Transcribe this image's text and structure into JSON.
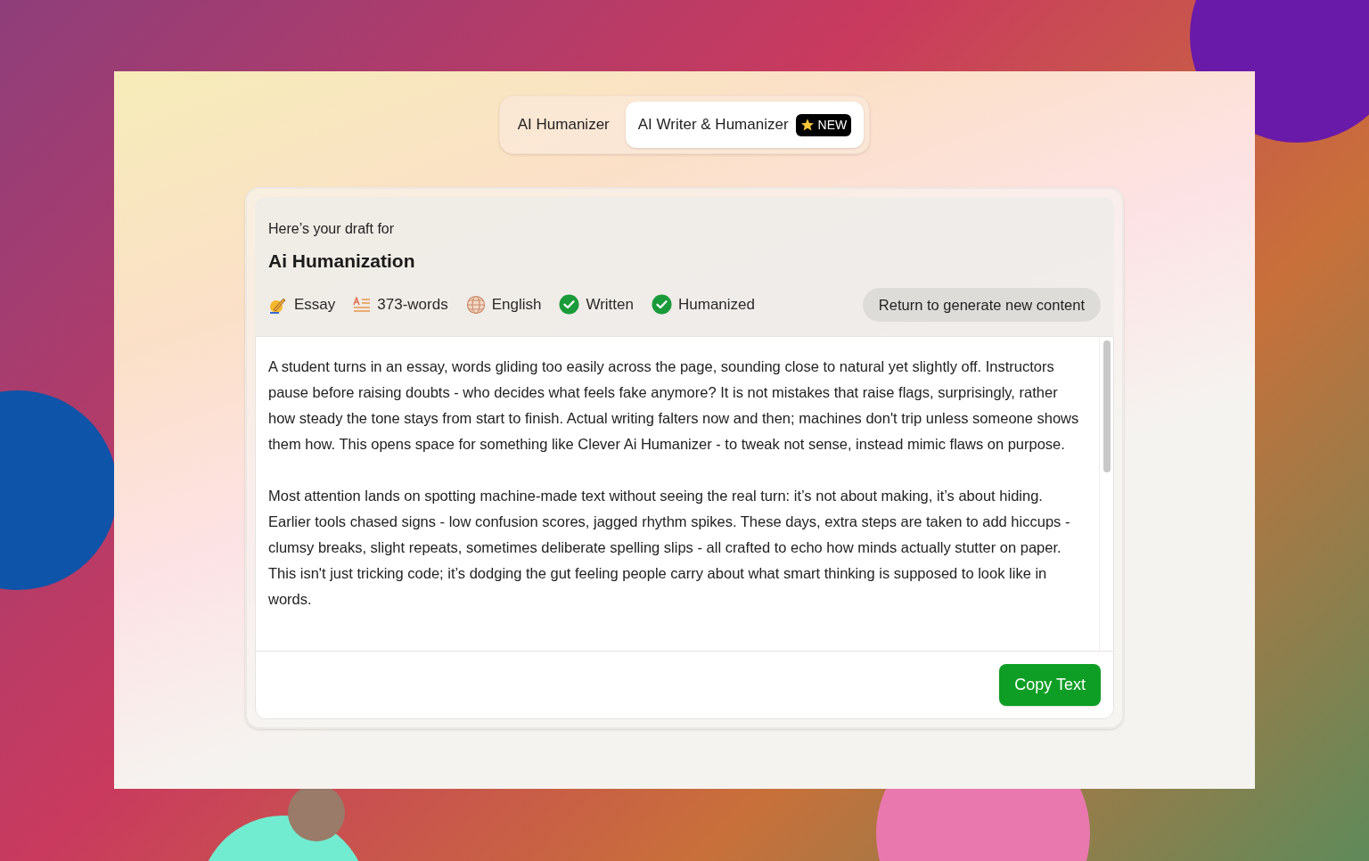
{
  "tabs": [
    {
      "label": "AI Humanizer",
      "selected": false
    },
    {
      "label": "AI Writer & Humanizer",
      "selected": true,
      "badge": "NEW"
    }
  ],
  "draft": {
    "intro": "Here’s your draft for",
    "title": "Ai Humanization",
    "meta": [
      {
        "kind": "pencil",
        "label": "Essay"
      },
      {
        "kind": "lines",
        "label": "373-words"
      },
      {
        "kind": "globe",
        "label": "English"
      },
      {
        "kind": "check",
        "label": "Written"
      },
      {
        "kind": "check",
        "label": "Humanized"
      }
    ],
    "return_button": "Return to generate new content",
    "paragraphs": [
      "A student turns in an essay, words gliding too easily across the page, sounding close to natural yet slightly off. Instructors pause before raising doubts - who decides what feels fake anymore? It is not mistakes that raise flags, surprisingly, rather how steady the tone stays from start to finish. Actual writing falters now and then; machines don't trip unless someone shows them how. This opens space for something like Clever Ai Humanizer - to tweak not sense, instead mimic flaws on purpose.",
      "Most attention lands on spotting machine-made text without seeing the real turn: it’s not about making, it’s about hiding. Earlier tools chased signs - low confusion scores, jagged rhythm spikes. These days, extra steps are taken to add hiccups - clumsy breaks, slight repeats, sometimes deliberate spelling slips - all crafted to echo how minds actually stutter on paper. This isn't just tricking code; it’s dodging the gut feeling people carry about what smart thinking is supposed to look like in words."
    ],
    "copy_button": "Copy Text"
  }
}
